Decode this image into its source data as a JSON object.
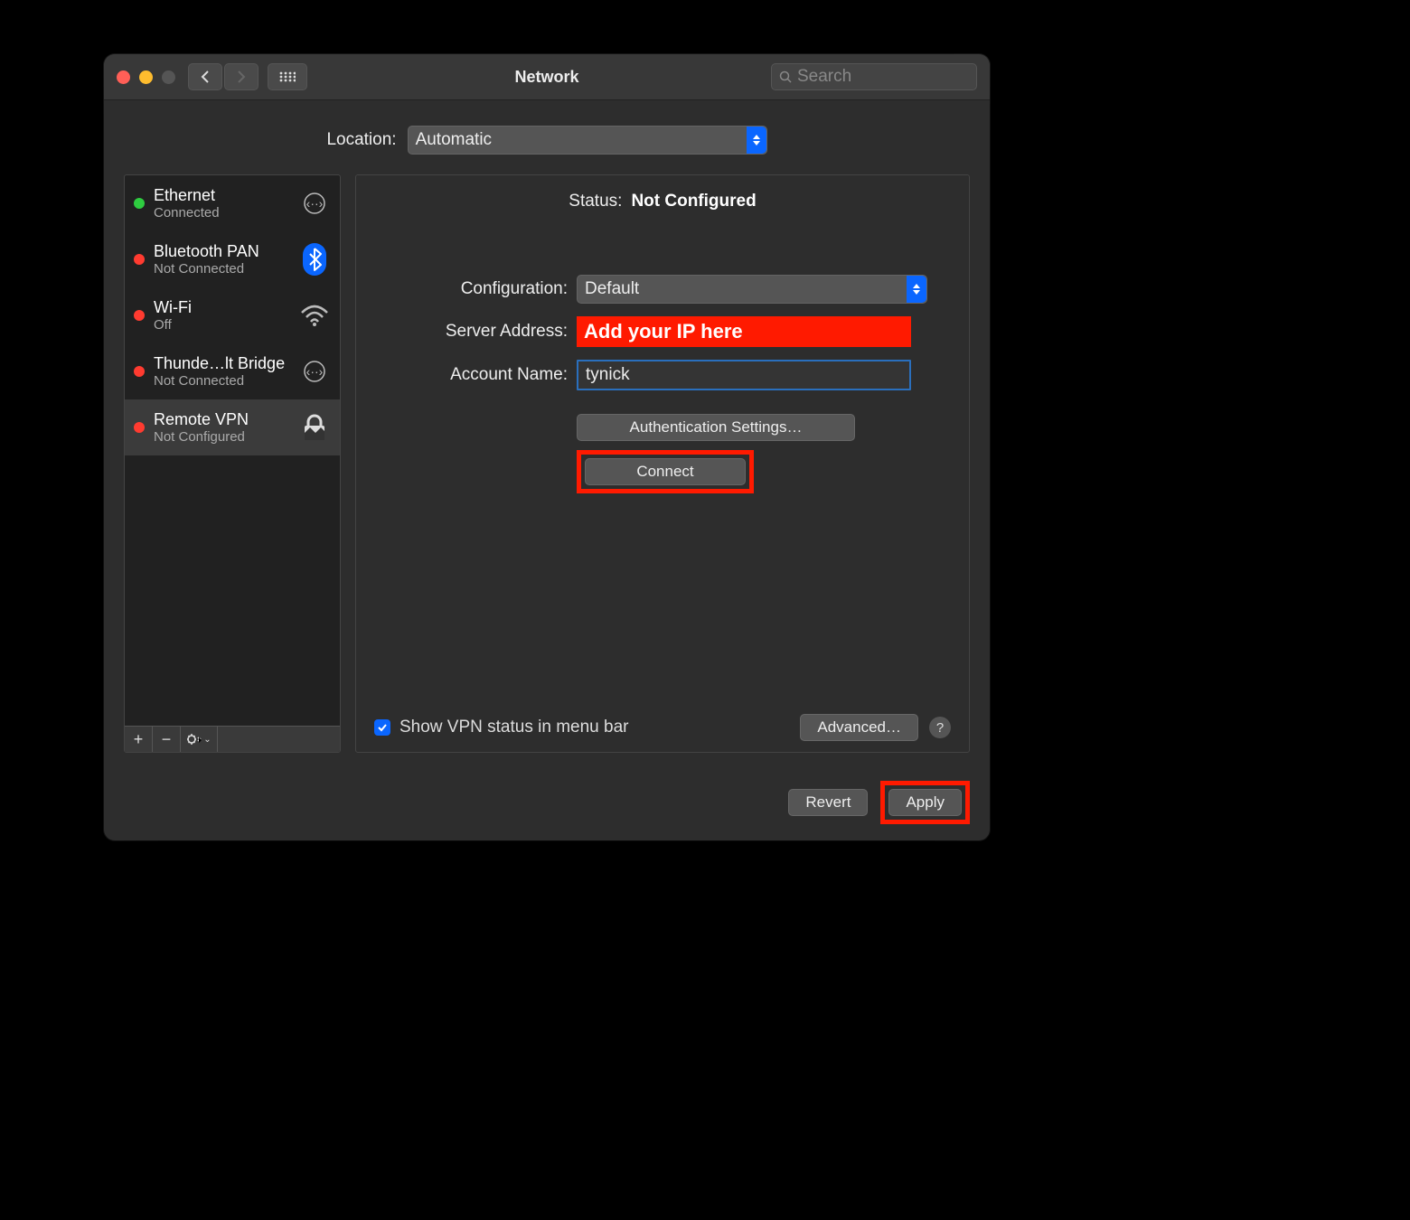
{
  "window": {
    "title": "Network"
  },
  "search": {
    "placeholder": "Search"
  },
  "location": {
    "label": "Location:",
    "value": "Automatic"
  },
  "sidebar": {
    "items": [
      {
        "name": "Ethernet",
        "sub": "Connected",
        "status": "green",
        "icon": "ethernet"
      },
      {
        "name": "Bluetooth PAN",
        "sub": "Not Connected",
        "status": "red",
        "icon": "bluetooth"
      },
      {
        "name": "Wi-Fi",
        "sub": "Off",
        "status": "red",
        "icon": "wifi"
      },
      {
        "name": "Thunde…lt Bridge",
        "sub": "Not Connected",
        "status": "red",
        "icon": "ethernet"
      },
      {
        "name": "Remote VPN",
        "sub": "Not Configured",
        "status": "red",
        "icon": "vpn"
      }
    ]
  },
  "detail": {
    "status_label": "Status:",
    "status_value": "Not Configured",
    "config_label": "Configuration:",
    "config_value": "Default",
    "server_label": "Server Address:",
    "server_overlay": "Add your IP here",
    "account_label": "Account Name:",
    "account_value": "tynick",
    "auth_button": "Authentication Settings…",
    "connect_button": "Connect",
    "show_vpn_label": "Show VPN status in menu bar",
    "advanced_button": "Advanced…"
  },
  "footer": {
    "revert": "Revert",
    "apply": "Apply"
  }
}
